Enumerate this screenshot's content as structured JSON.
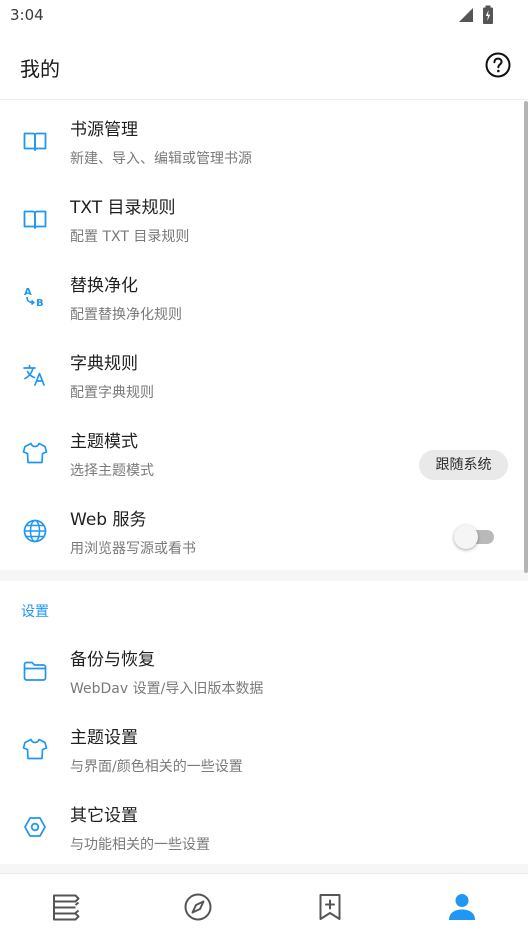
{
  "status_bar": {
    "time": "3:04"
  },
  "header": {
    "title": "我的",
    "help_icon": "help-circle-icon"
  },
  "colors": {
    "accent": "#2196f3",
    "icon_gray": "#555555"
  },
  "main_items": [
    {
      "icon": "book-open-icon",
      "title": "书源管理",
      "summary": "新建、导入、编辑或管理书源"
    },
    {
      "icon": "book-open-icon",
      "title": "TXT 目录规则",
      "summary": "配置 TXT 目录规则"
    },
    {
      "icon": "swap-ab-icon",
      "title": "替换净化",
      "summary": "配置替换净化规则"
    },
    {
      "icon": "translate-icon",
      "title": "字典规则",
      "summary": "配置字典规则"
    },
    {
      "icon": "shirt-icon",
      "title": "主题模式",
      "summary": "选择主题模式",
      "value": "跟随系统"
    },
    {
      "icon": "globe-icon",
      "title": "Web 服务",
      "summary": "用浏览器写源或看书",
      "enabled": false
    }
  ],
  "settings": {
    "category": "设置",
    "items": [
      {
        "icon": "folder-icon",
        "title": "备份与恢复",
        "summary": "WebDav 设置/导入旧版本数据"
      },
      {
        "icon": "shirt-icon",
        "title": "主题设置",
        "summary": "与界面/颜色相关的一些设置"
      },
      {
        "icon": "hexagon-settings-icon",
        "title": "其它设置",
        "summary": "与功能相关的一些设置"
      }
    ]
  },
  "bottom_nav": [
    {
      "icon": "bookshelf-icon",
      "active": false
    },
    {
      "icon": "compass-icon",
      "active": false
    },
    {
      "icon": "bookmark-add-icon",
      "active": false
    },
    {
      "icon": "person-icon",
      "active": true
    }
  ]
}
